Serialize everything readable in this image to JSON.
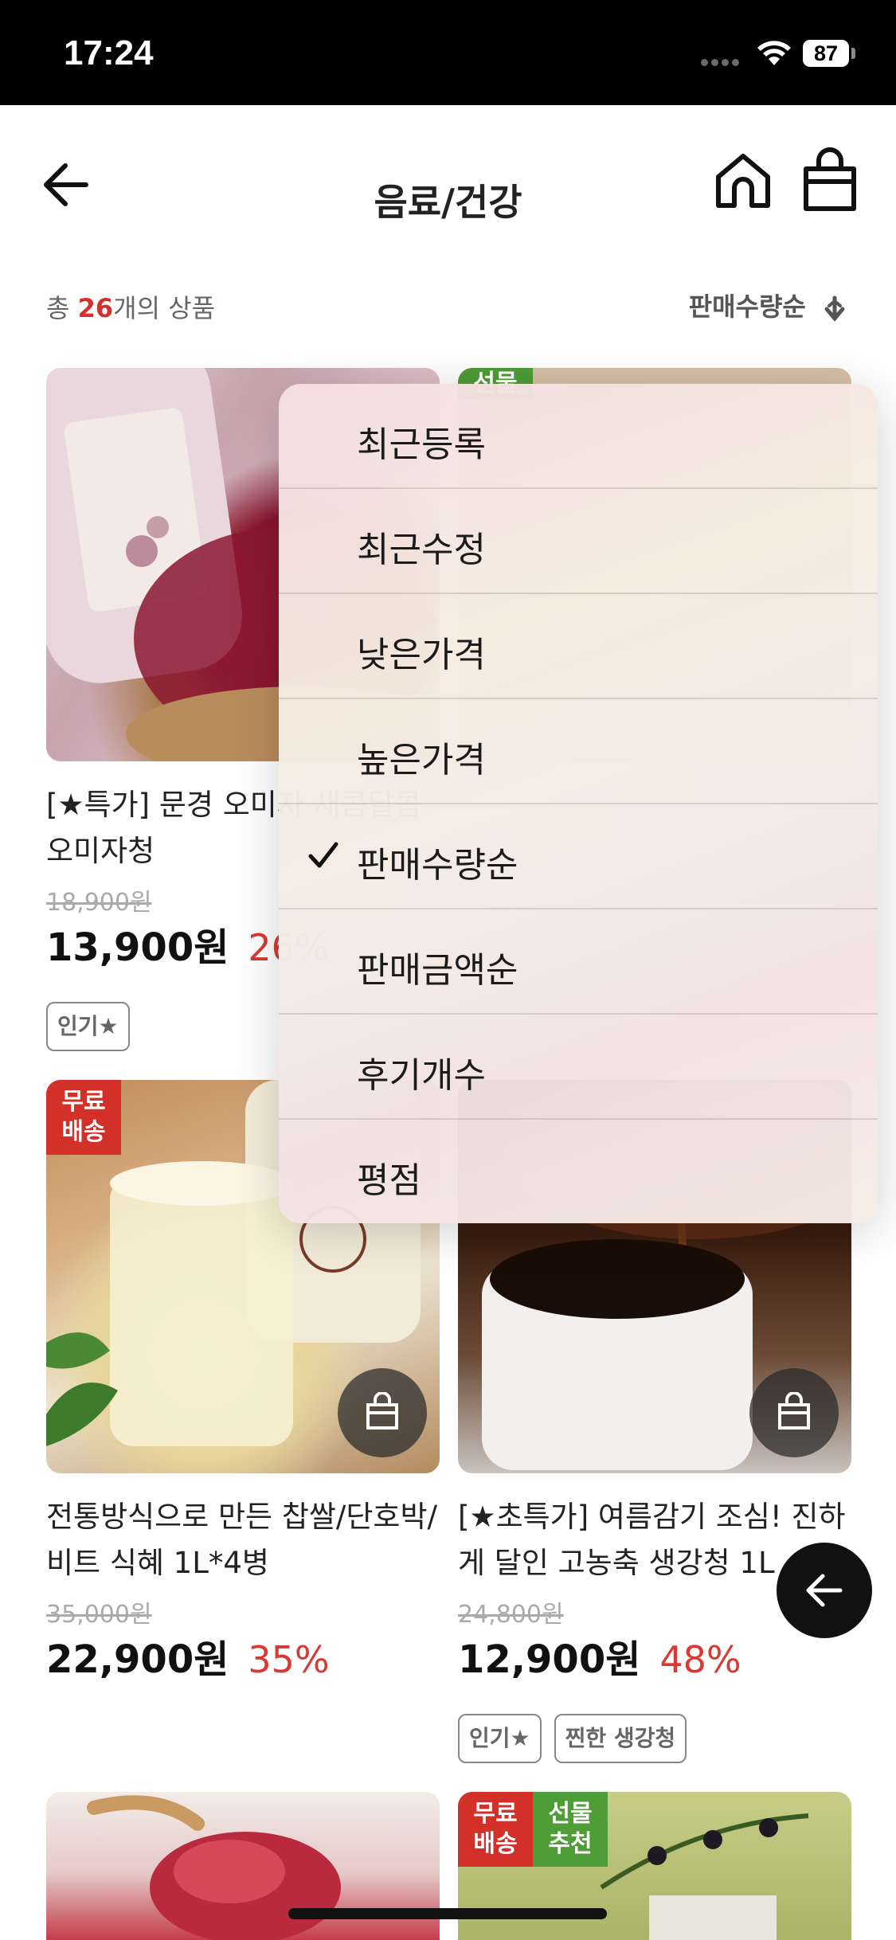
{
  "status_bar": {
    "time": "17:24",
    "battery": "87"
  },
  "header": {
    "title": "음료/건강"
  },
  "summary": {
    "prefix": "총 ",
    "count": "26",
    "suffix": "개의 상품",
    "sort_label": "판매수량순"
  },
  "sort_menu": {
    "items": [
      {
        "label": "최근등록",
        "selected": false
      },
      {
        "label": "최근수정",
        "selected": false
      },
      {
        "label": "낮은가격",
        "selected": false
      },
      {
        "label": "높은가격",
        "selected": false
      },
      {
        "label": "판매수량순",
        "selected": true
      },
      {
        "label": "판매금액순",
        "selected": false
      },
      {
        "label": "후기개수",
        "selected": false
      },
      {
        "label": "평점",
        "selected": false
      }
    ]
  },
  "products": [
    {
      "name": "[★특가] 문경 오미자 새콤달콤 오미자청",
      "original_price": "18,900원",
      "price": "13,900원",
      "discount": "26%",
      "tags": [
        "인기★"
      ],
      "badges": []
    },
    {
      "name": "",
      "badges": [
        "선물 추천"
      ]
    },
    {
      "name": "전통방식으로 만든 찹쌀/단호박/비트 식혜 1L*4병",
      "original_price": "35,000원",
      "price": "22,900원",
      "discount": "35%",
      "tags": [],
      "badges": [
        "무료 배송"
      ]
    },
    {
      "name": "[★초특가] 여름감기 조심! 진하게 달인 고농축 생강청 1L",
      "original_price": "24,800원",
      "price": "12,900원",
      "discount": "48%",
      "tags": [
        "인기★",
        "찐한 생강청"
      ],
      "badges": []
    },
    {
      "name": "",
      "badges": []
    },
    {
      "name": "",
      "badges": [
        "무료 배송",
        "선물 추천"
      ]
    }
  ],
  "badge_labels": {
    "free_shipping": "무료\n배송",
    "gift": "선물\n추천"
  }
}
